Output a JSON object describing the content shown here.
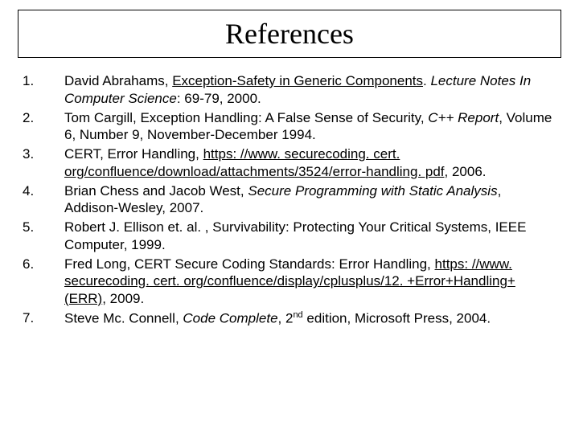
{
  "title": "References",
  "refs": {
    "r1": {
      "a": "David Abrahams, ",
      "link": "Exception-Safety in Generic Components",
      "b": ". ",
      "ital": "Lecture Notes In Computer Science",
      "c": ": 69-79, 2000."
    },
    "r2": {
      "a": "Tom Cargill, Exception Handling: A False Sense of Security, ",
      "ital": "C++ Report",
      "b": ", Volume 6, Number 9, November-December 1994."
    },
    "r3": {
      "a": "CERT, Error Handling, ",
      "link": "https: //www. securecoding. cert. org/confluence/download/attachments/3524/error-handling. pdf",
      "b": ", 2006."
    },
    "r4": {
      "a": "Brian Chess and Jacob West, ",
      "ital": "Secure Programming with Static Analysis",
      "b": ", Addison-Wesley, 2007."
    },
    "r5": {
      "a": "Robert J. Ellison et. al. , Survivability: Protecting Your Critical Systems, IEEE Computer, 1999."
    },
    "r6": {
      "a": "Fred Long, CERT Secure Coding Standards: Error Handling, ",
      "link": "https: //www. securecoding. cert. org/confluence/display/cplusplus/12. +Error+Handling+(ERR)",
      "b": ", 2009."
    },
    "r7": {
      "a": "Steve Mc. Connell, ",
      "ital": "Code Complete",
      "b": ", 2",
      "sup": "nd",
      "c": " edition",
      "d": ", Microsoft Press, 2004."
    }
  }
}
